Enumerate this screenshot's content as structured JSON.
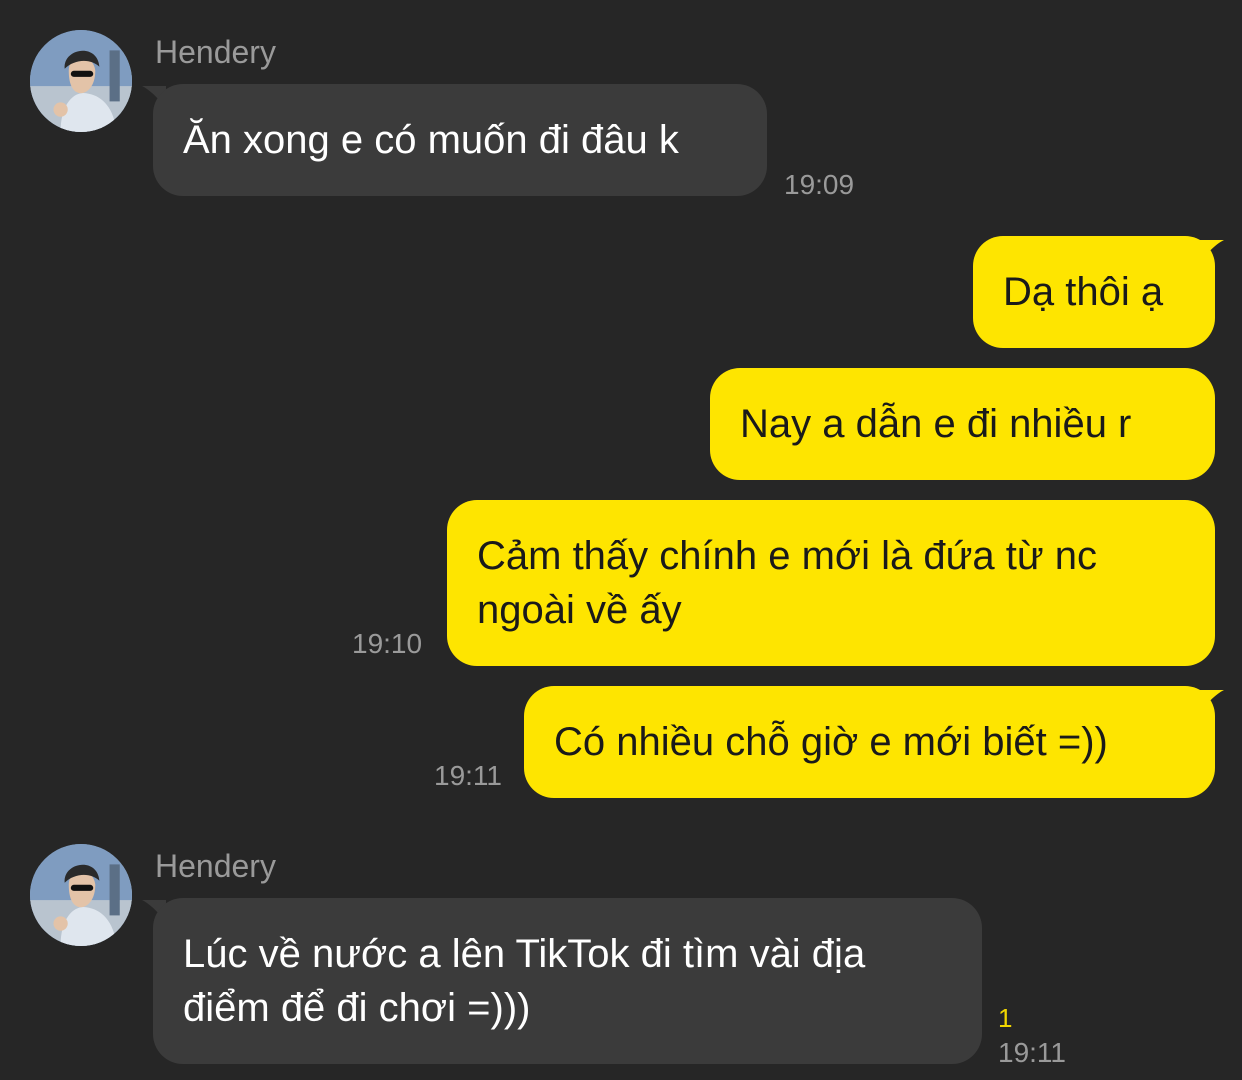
{
  "messages": [
    {
      "sender": "Hendery",
      "text": "Ăn xong e có muốn đi đâu k",
      "time": "19:09"
    },
    {
      "text": "Dạ thôi ạ"
    },
    {
      "text": "Nay a dẫn e đi nhiều r"
    },
    {
      "text": "Cảm thấy chính e mới là đứa từ nc ngoài về ấy",
      "time": "19:10"
    },
    {
      "text": "Có nhiều chỗ giờ e mới biết =))",
      "time": "19:11"
    },
    {
      "sender": "Hendery",
      "text": "Lúc về nước a lên TikTok đi tìm vài địa điểm để đi chơi =)))",
      "time": "19:11",
      "unread": "1"
    }
  ],
  "colors": {
    "incoming": "#3b3b3b",
    "outgoing": "#fee500",
    "background": "#262626"
  }
}
